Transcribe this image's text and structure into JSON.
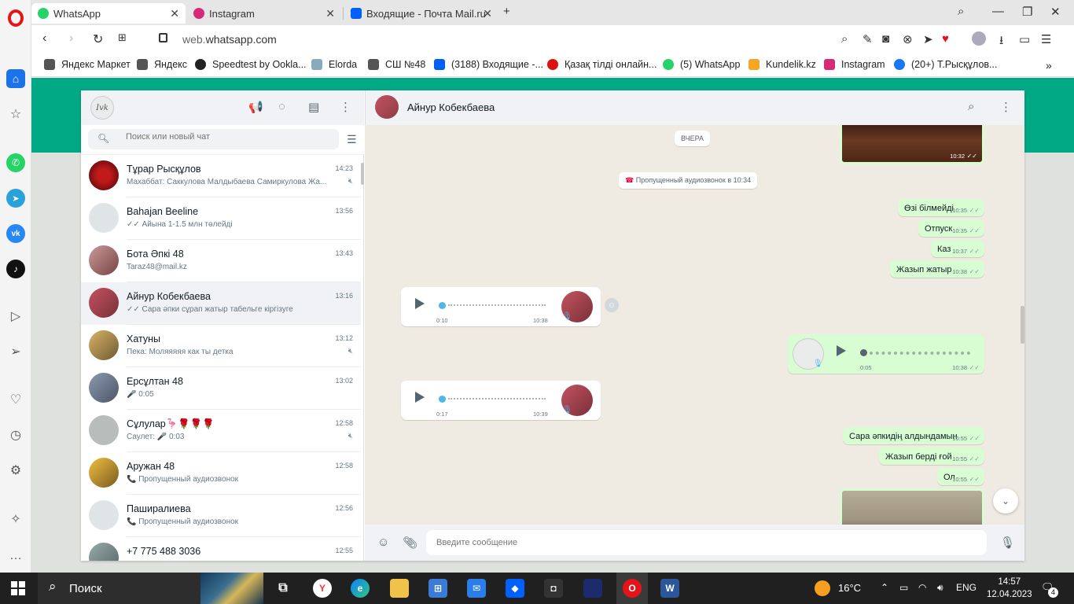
{
  "browser": {
    "tabs": [
      {
        "label": "WhatsApp",
        "active": true
      },
      {
        "label": "Instagram",
        "active": false
      },
      {
        "label": "Входящие - Почта Mail.ru",
        "active": false
      }
    ],
    "url_host": "web.",
    "url_domain": "whatsapp.com",
    "bookmarks": [
      "Яндекс Маркет",
      "Яндекс",
      "Speedtest by Ookla...",
      "Elorda",
      "СШ №48",
      "(3188) Входящие -...",
      "Қазақ тілді онлайн...",
      "(5) WhatsApp",
      "Kundelik.kz",
      "Instagram",
      "(20+) Т.Рысқұлов..."
    ]
  },
  "whatsapp": {
    "my_avatar_text": "Ivk",
    "search_placeholder": "Поиск или новый чат",
    "chats": [
      {
        "name": "Тұрар Рысқұлов",
        "time": "14:23",
        "preview": "Махаббат: Саккулова  Малдыбаева  Самиркулова  Жа...",
        "muted": true
      },
      {
        "name": "Bahajan Beeline",
        "time": "13:56",
        "preview": "✓✓ Айына 1-1.5 млн төлейді",
        "muted": false
      },
      {
        "name": "Бота Әпкі 48",
        "time": "13:43",
        "preview": "Taraz48@mail.kz",
        "muted": false
      },
      {
        "name": "Айнур Кобекбаева",
        "time": "13:16",
        "preview": "✓✓ Сара әпки сұрап жатыр табельге кіргізуге",
        "muted": false,
        "selected": true
      },
      {
        "name": "Хатуны",
        "time": "13:12",
        "preview": "Пека: Моляяяяя как ты детка",
        "muted": true
      },
      {
        "name": "Ерсұлтан 48",
        "time": "13:02",
        "preview": "🎤 0:05",
        "muted": false
      },
      {
        "name": "Сұлулар🦩🌹🌹🌹",
        "time": "12:58",
        "preview": "Саулет: 🎤 0:03",
        "muted": true
      },
      {
        "name": "Аружан 48",
        "time": "12:58",
        "preview": "📞 Пропущенный аудиозвонок",
        "muted": false
      },
      {
        "name": "Паширалиева",
        "time": "12:56",
        "preview": "📞 Пропущенный аудиозвонок",
        "muted": false
      },
      {
        "name": "+7 775 488 3036",
        "time": "12:55",
        "preview": "",
        "muted": false
      }
    ],
    "active_chat": {
      "name": "Айнур Кобекбаева",
      "date_label": "ВЧЕРА",
      "missed_call": "Пропущенный аудиозвонок в 10:34",
      "image_top_time": "10:32",
      "messages": [
        {
          "text": "Өзі білмейді",
          "time": "10:35"
        },
        {
          "text": "Отпуск",
          "time": "10:35"
        },
        {
          "text": "Каз",
          "time": "10:37"
        },
        {
          "text": "Жазып жатыр",
          "time": "10:38"
        }
      ],
      "voice_1": {
        "duration": "0:10",
        "time": "10:38"
      },
      "voice_2": {
        "duration": "0:05",
        "time": "10:38"
      },
      "voice_3": {
        "duration": "0:17",
        "time": "10:39"
      },
      "messages_2": [
        {
          "text": "Сара әпкидің алдындамын",
          "time": "10:55"
        },
        {
          "text": "Жазып берді ғой",
          "time": "10:55"
        },
        {
          "text": "Ол",
          "time": "10:55"
        }
      ],
      "composer_placeholder": "Введите сообщение"
    }
  },
  "taskbar": {
    "search_label": "Поиск",
    "temperature": "16°C",
    "language": "ENG",
    "time": "14:57",
    "date": "12.04.2023",
    "notification_count": "4"
  }
}
